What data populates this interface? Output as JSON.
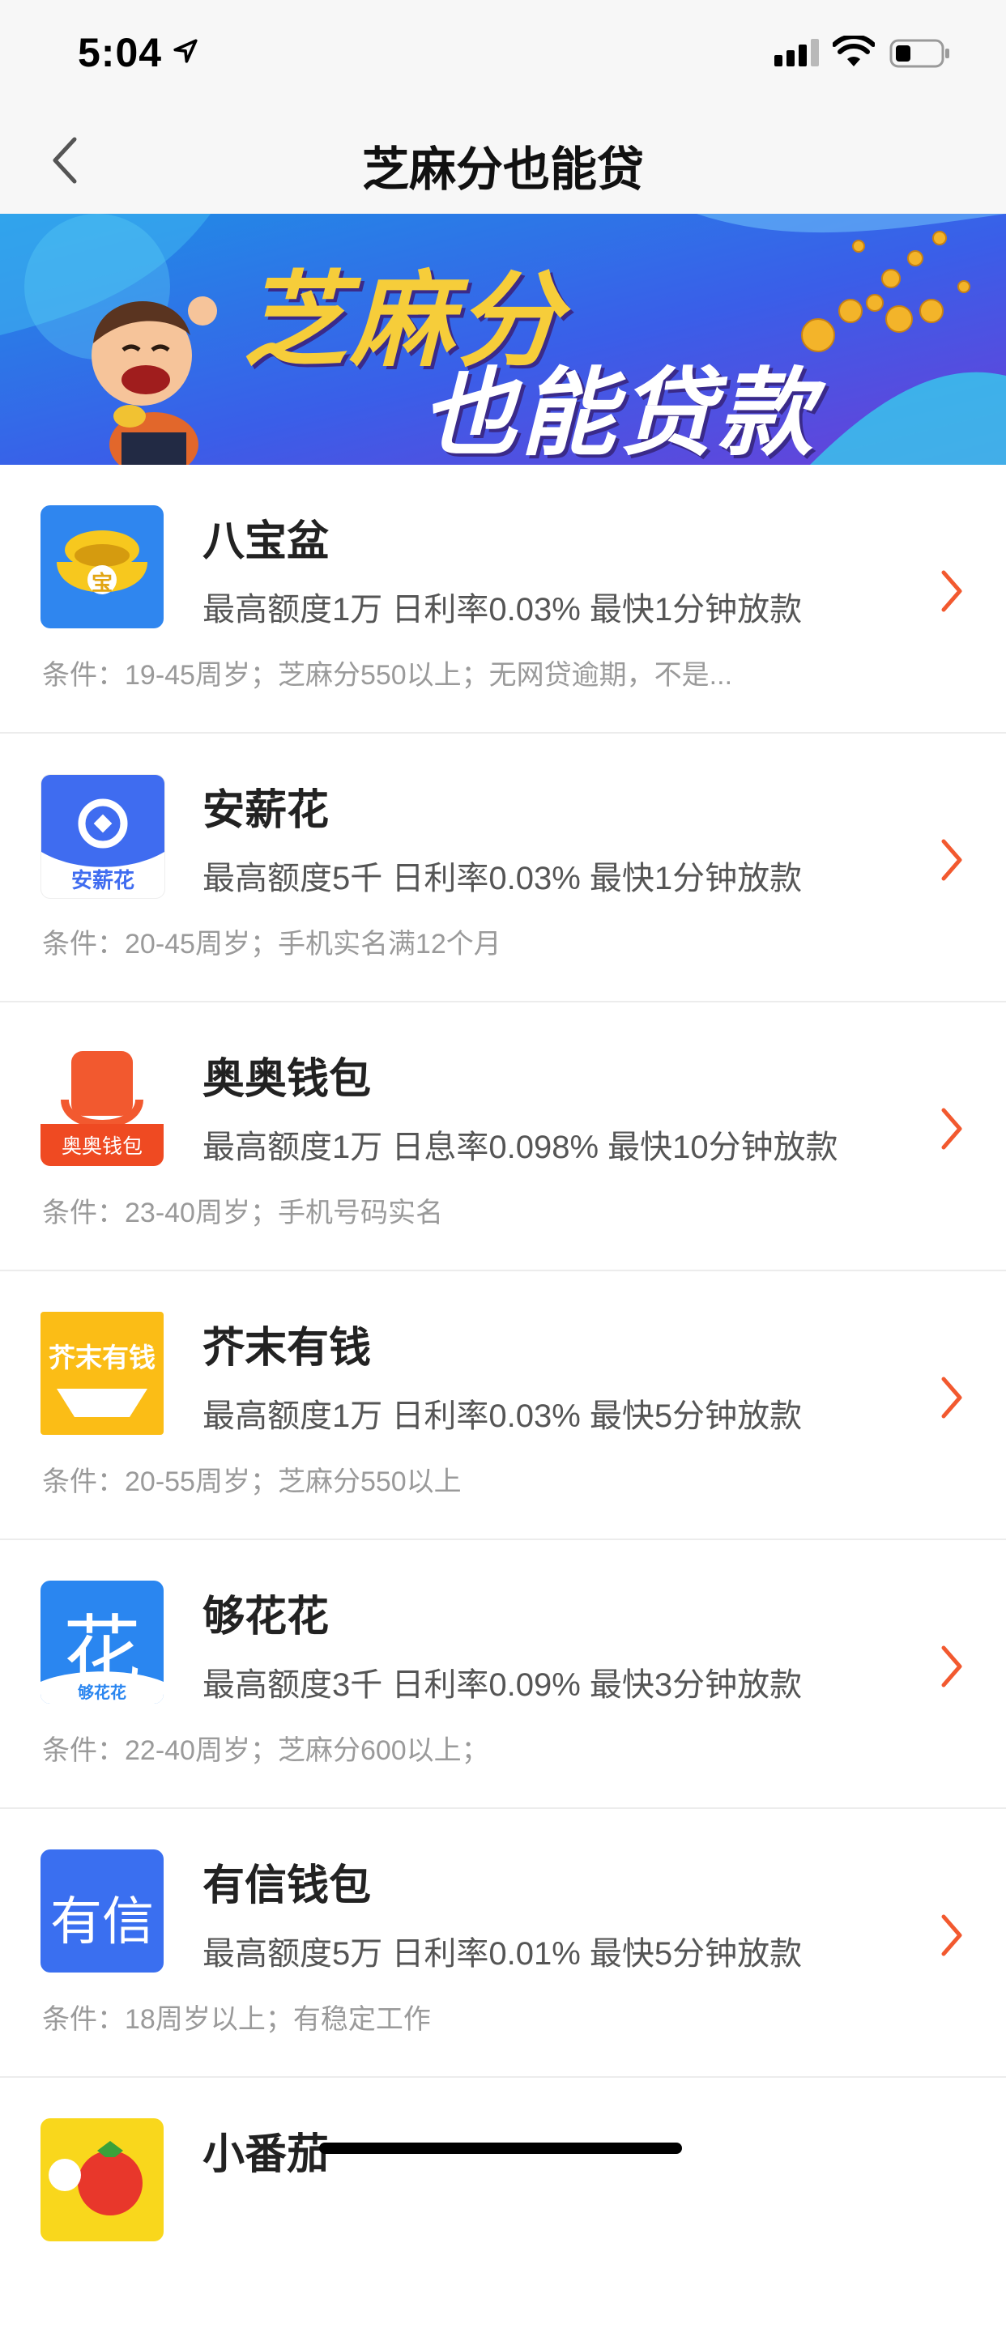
{
  "status_bar": {
    "time": "5:04"
  },
  "header": {
    "title": "芝麻分也能贷"
  },
  "banner": {
    "line1": "芝麻分",
    "line2": "也能贷款"
  },
  "loans": [
    {
      "name": "八宝盆",
      "logo_text": "宝",
      "desc": "最高额度1万 日利率0.03% 最快1分钟放款",
      "cond": "条件：19-45周岁；芝麻分550以上；无网贷逾期，不是..."
    },
    {
      "name": "安薪花",
      "logo_text": "安薪花",
      "desc": "最高额度5千 日利率0.03% 最快1分钟放款",
      "cond": "条件：20-45周岁；手机实名满12个月"
    },
    {
      "name": "奥奥钱包",
      "logo_text": "奥奥钱包",
      "desc": "最高额度1万 日息率0.098% 最快10分钟放款",
      "cond": "条件：23-40周岁；手机号码实名"
    },
    {
      "name": "芥末有钱",
      "logo_text": "芥末有钱",
      "desc": "最高额度1万 日利率0.03% 最快5分钟放款",
      "cond": "条件：20-55周岁；芝麻分550以上"
    },
    {
      "name": "够花花",
      "logo_text": "够花花",
      "logo_big": "花",
      "desc": "最高额度3千 日利率0.09% 最快3分钟放款",
      "cond": "条件：22-40周岁；芝麻分600以上；"
    },
    {
      "name": "有信钱包",
      "logo_text": "有信",
      "desc": "最高额度5万 日利率0.01% 最快5分钟放款",
      "cond": "条件：18周岁以上；有稳定工作"
    },
    {
      "name": "小番茄"
    }
  ],
  "colors": {
    "accent": "#f2592f",
    "nav_bg": "#f7f7f7",
    "banner_gold": "#f6cd3a"
  },
  "icons": [
    "location-arrow-icon",
    "signal-icon",
    "wifi-icon",
    "battery-icon",
    "back-chevron-icon",
    "chevron-right-icon"
  ]
}
